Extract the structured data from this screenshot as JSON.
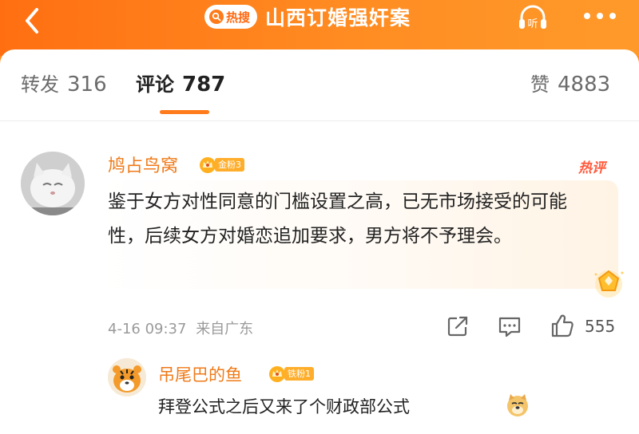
{
  "header": {
    "hot_label": "热搜",
    "title": "山西订婚强奸案",
    "listen_label": "听"
  },
  "tabs": [
    {
      "label": "转发",
      "count": "316"
    },
    {
      "label": "评论",
      "count": "787"
    },
    {
      "label": "赞",
      "count": "4883"
    }
  ],
  "comment": {
    "username": "鸠占鸟窝",
    "fan_badge": "金粉3",
    "hot_tag": "热评",
    "text": "鉴于女方对性同意的门槛设置之高，已无市场接受的可能性，后续女方对婚恋追加要求，男方将不予理会。",
    "time": "4-16 09:37",
    "location": "来自广东",
    "likes": "555"
  },
  "reply": {
    "username": "吊尾巴的鱼",
    "fan_badge": "铁粉1",
    "text": "拜登公式之后又来了个财政部公式"
  },
  "colors": {
    "header_orange": "#ff7a19",
    "username_orange": "#ef7a18",
    "hot_red": "#ff5a3c"
  }
}
